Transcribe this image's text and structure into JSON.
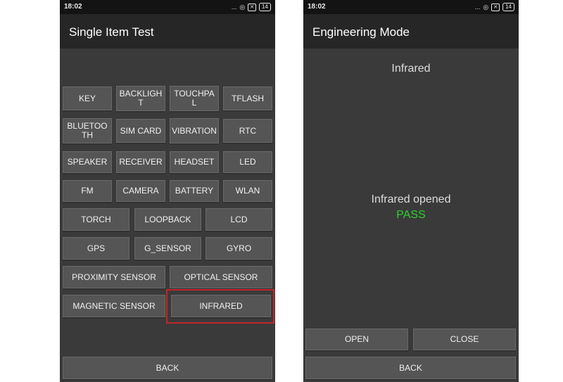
{
  "left_screen": {
    "status_time": "18:02",
    "status_icons": "...",
    "battery": "14",
    "title": "Single Item Test",
    "buttons": {
      "key": "KEY",
      "backlight": "BACKLIGHT",
      "touchpal": "TOUCHPAL",
      "tflash": "TFLASH",
      "bluetooth": "BLUETOOTH",
      "sim_card": "SIM CARD",
      "vibration": "VIBRATION",
      "rtc": "RTC",
      "speaker": "SPEAKER",
      "receiver": "RECEIVER",
      "headset": "HEADSET",
      "led": "LED",
      "fm": "FM",
      "camera": "CAMERA",
      "battery": "BATTERY",
      "wlan": "WLAN",
      "torch": "TORCH",
      "loopback": "LOOPBACK",
      "lcd": "LCD",
      "gps": "GPS",
      "g_sensor": "G_SENSOR",
      "gyro": "GYRO",
      "proximity_sensor": "PROXIMITY SENSOR",
      "optical_sensor": "OPTICAL SENSOR",
      "magnetic_sensor": "MAGNETIC SENSOR",
      "infrared": "INFRARED"
    },
    "selected_item": "infrared",
    "selection_color": "#c4252b",
    "back": "BACK"
  },
  "right_screen": {
    "status_time": "18:02",
    "status_icons": "...",
    "battery": "14",
    "title": "Engineering Mode",
    "heading": "Infrared",
    "status_message": "Infrared opened",
    "result": "PASS",
    "result_color": "#2ed12e",
    "open": "OPEN",
    "close": "CLOSE",
    "back": "BACK"
  }
}
